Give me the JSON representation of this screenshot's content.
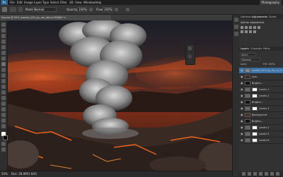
{
  "menubar": {
    "app_icon": "Ps",
    "items": [
      "File",
      "Edit",
      "Image",
      "Layer",
      "Type",
      "Select",
      "Filter",
      "3D",
      "View",
      "Window",
      "Help"
    ],
    "workspace": "Photography"
  },
  "options": {
    "mode_label": "Mode:",
    "mode_value": "Normal",
    "opacity_label": "Opacity:",
    "opacity_value": "100%",
    "flow_label": "Flow:",
    "flow_value": "100%"
  },
  "document": {
    "tab_title": "Poured @ 50% (smoke_053_by_ms_of(m),RGB/8)* ×"
  },
  "status": {
    "zoom": "50%",
    "doc_size": "Doc: 28.8M/1.60G"
  },
  "panels": {
    "top_tabs": [
      "Libraries",
      "Adjustments",
      "Styles"
    ],
    "adjust_label": "Add an adjustment",
    "layers_tabs": [
      "Layers",
      "Channels",
      "Paths"
    ],
    "kind_label": "Kind",
    "blend_label": "Normal",
    "lock_label": "Lock:",
    "fill_label": "Fill: 100%",
    "layers": [
      {
        "name": "smoke_053_by_ms_or_fr..",
        "selected": true
      },
      {
        "name": "rock",
        "selected": false
      },
      {
        "name": "Brightn…",
        "selected": false
      },
      {
        "name": "Levels 1",
        "selected": false
      },
      {
        "name": "Levels 2",
        "selected": false
      },
      {
        "name": "Brightn…",
        "selected": false
      },
      {
        "name": "Levels 3",
        "selected": false
      },
      {
        "name": "Background",
        "selected": false
      },
      {
        "name": "Brightn…",
        "selected": false
      },
      {
        "name": "Levels 4",
        "selected": false
      },
      {
        "name": "Levels 5",
        "selected": false
      },
      {
        "name": "Levels 6",
        "selected": false
      }
    ]
  },
  "colors": {
    "accent": "#3a72a8",
    "fg_swatch": "#ffffff",
    "bg_swatch": "#000000"
  }
}
